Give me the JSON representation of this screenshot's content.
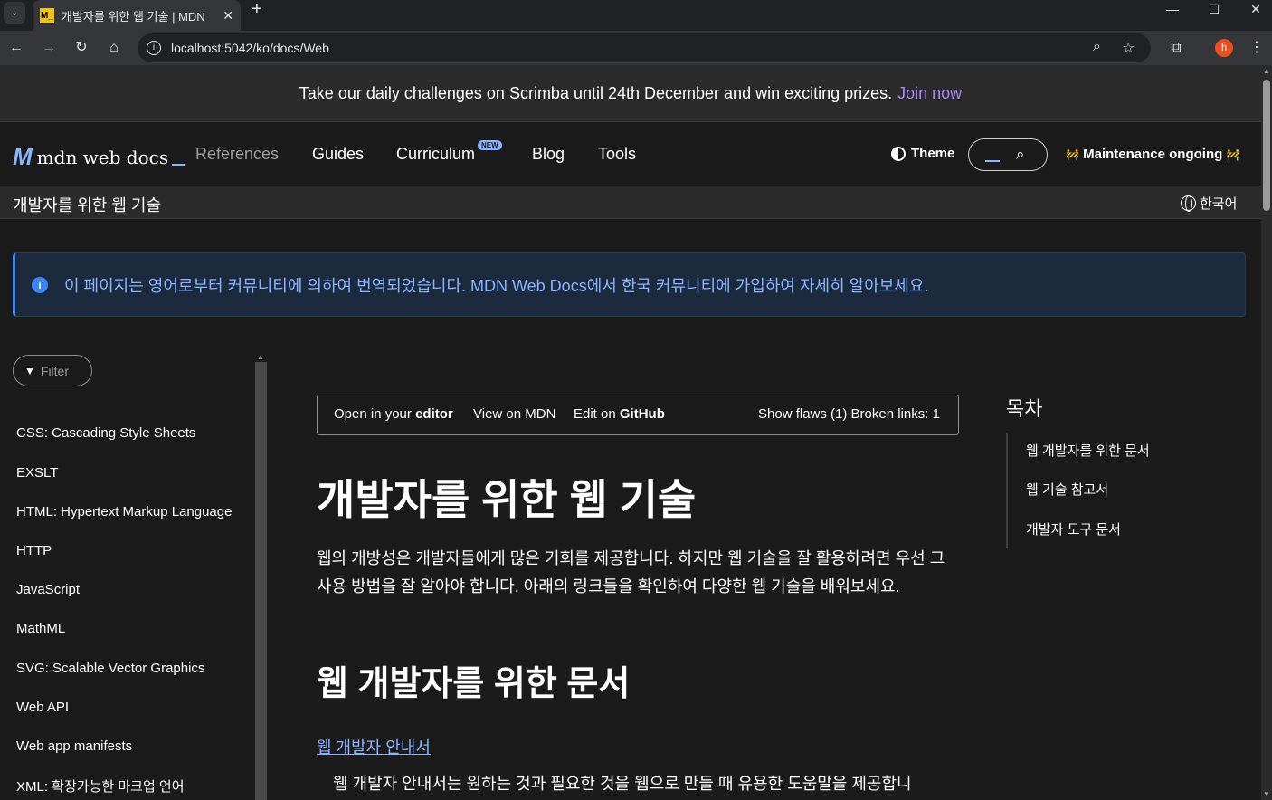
{
  "browser": {
    "tab_title": "개발자를 위한 웹 기술 | MDN",
    "favicon_text": "M_",
    "url": "localhost:5042/ko/docs/Web",
    "avatar_letter": "h"
  },
  "banner": {
    "text": "Take our daily challenges on Scrimba until 24th December and win exciting prizes.",
    "link": "Join now"
  },
  "header": {
    "logo_text": "mdn web docs",
    "nav": [
      "References",
      "Guides",
      "Curriculum",
      "Blog",
      "Tools"
    ],
    "new_badge": "NEW",
    "theme_label": "Theme",
    "maintenance": "Maintenance ongoing"
  },
  "crumbbar": {
    "title": "개발자를 위한 웹 기술",
    "language": "한국어"
  },
  "notice": {
    "text": "이 페이지는 영어로부터 커뮤니티에 의하여 번역되었습니다. MDN Web Docs에서 한국 커뮤니티에 가입하여 자세히 알아보세요."
  },
  "sidebar": {
    "filter_placeholder": "Filter",
    "items": [
      "CSS: Cascading Style Sheets",
      "EXSLT",
      "HTML: Hypertext Markup Language",
      "HTTP",
      "JavaScript",
      "MathML",
      "SVG: Scalable Vector Graphics",
      "Web API",
      "Web app manifests",
      "XML: 확장가능한 마크업 언어"
    ]
  },
  "editor_bar": {
    "open_prefix": "Open in your",
    "open_bold": "editor",
    "view_mdn": "View on MDN",
    "edit_prefix": "Edit on",
    "edit_bold": "GitHub",
    "flaws": "Show flaws (1) Broken links: 1"
  },
  "article": {
    "h1": "개발자를 위한 웹 기술",
    "intro": "웹의 개방성은 개발자들에게 많은 기회를 제공합니다. 하지만 웹 기술을 잘 활용하려면 우선 그 사용 방법을 잘 알아야 합니다. 아래의 링크들을 확인하여 다양한 웹 기술을 배워보세요.",
    "h2": "웹 개발자를 위한 문서",
    "link": "웹 개발자 안내서",
    "desc": "웹 개발자 안내서는 원하는 것과 필요한 것을 웹으로 만들 때 유용한 도움말을 제공합니"
  },
  "toc": {
    "title": "목차",
    "items": [
      "웹 개발자를 위한 문서",
      "웹 기술 참고서",
      "개발자 도구 문서"
    ]
  }
}
